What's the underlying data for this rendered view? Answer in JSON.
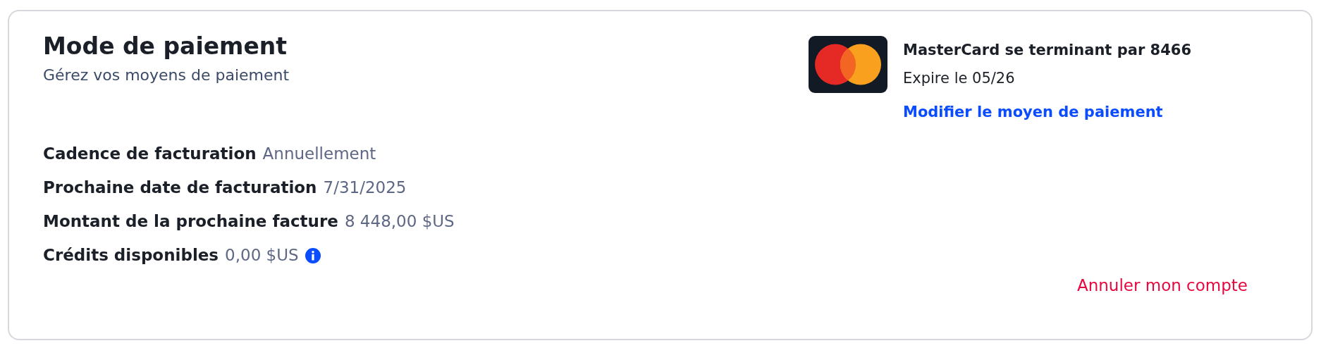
{
  "title": "Mode de paiement",
  "subtitle": "Gérez vos moyens de paiement",
  "details": [
    {
      "label": "Cadence de facturation",
      "value": "Annuellement",
      "info": false
    },
    {
      "label": "Prochaine date de facturation",
      "value": "7/31/2025",
      "info": false
    },
    {
      "label": "Montant de la prochaine facture",
      "value": "8 448,00 $US",
      "info": false
    },
    {
      "label": "Crédits disponibles",
      "value": "0,00 $US",
      "info": true
    }
  ],
  "card": {
    "name": "MasterCard se terminant par 8466",
    "expiry": "Expire le 05/26",
    "link": "Modifier le moyen de paiement"
  },
  "cancel_link": "Annuler mon compte"
}
